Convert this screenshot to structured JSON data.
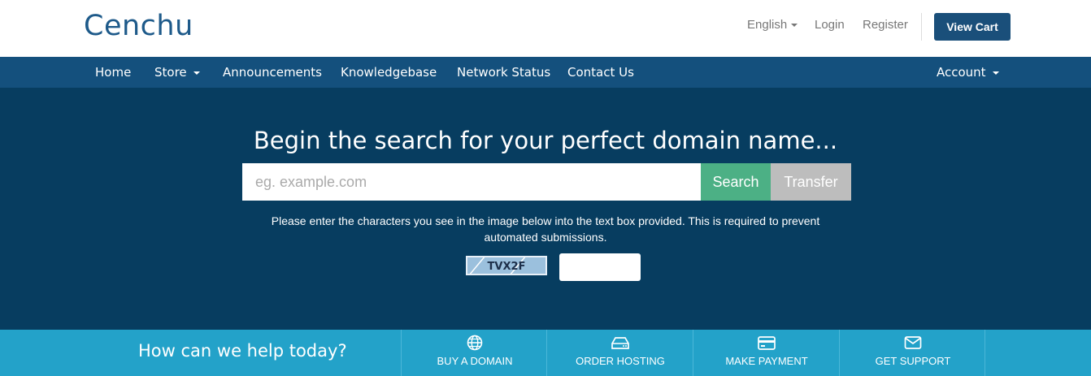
{
  "header": {
    "logo": "Cenchu",
    "language": "English",
    "login": "Login",
    "register": "Register",
    "view_cart": "View Cart"
  },
  "nav": {
    "items": [
      {
        "label": "Home"
      },
      {
        "label": "Store",
        "has_dropdown": true
      },
      {
        "label": "Announcements"
      },
      {
        "label": "Knowledgebase"
      },
      {
        "label": "Network Status"
      },
      {
        "label": "Contact Us"
      }
    ],
    "account": "Account"
  },
  "hero": {
    "title": "Begin the search for your perfect domain name...",
    "search_placeholder": "eg. example.com",
    "search_value": "",
    "search_button": "Search",
    "transfer_button": "Transfer",
    "captcha_instructions": "Please enter the characters you see in the image below into the text box provided. This is required to prevent automated submissions.",
    "captcha_image_text": "TVX2F",
    "captcha_value": ""
  },
  "footer_bar": {
    "help_text": "How can we help today?",
    "actions": [
      {
        "label": "BUY A DOMAIN",
        "icon": "globe-icon"
      },
      {
        "label": "ORDER HOSTING",
        "icon": "hard-drive-icon"
      },
      {
        "label": "MAKE PAYMENT",
        "icon": "credit-card-icon"
      },
      {
        "label": "GET SUPPORT",
        "icon": "envelope-icon"
      }
    ]
  },
  "colors": {
    "brand": "#1a4f7a",
    "nav_bg": "#14507d",
    "hero_bg": "#073d60",
    "search_green": "#4cb085",
    "transfer_gray": "#bdbdbd",
    "bottom_bar": "#23a2c9"
  }
}
